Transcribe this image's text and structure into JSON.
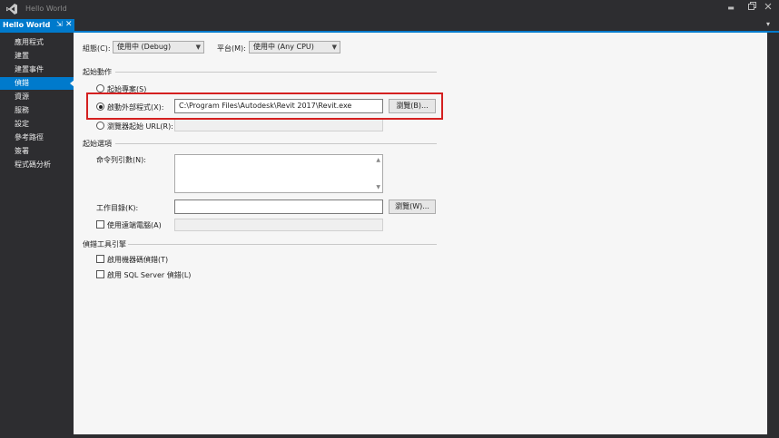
{
  "window": {
    "title": "Hello World",
    "min_glyph": "▬",
    "dropdown_glyph": "▾"
  },
  "tab": {
    "label": "Hello World",
    "pin_glyph": "⇲",
    "close_glyph": "✕"
  },
  "sidebar": {
    "items": [
      {
        "label": "應用程式",
        "selected": false
      },
      {
        "label": "建置",
        "selected": false
      },
      {
        "label": "建置事件",
        "selected": false
      },
      {
        "label": "偵錯",
        "selected": true
      },
      {
        "label": "資源",
        "selected": false
      },
      {
        "label": "服務",
        "selected": false
      },
      {
        "label": "設定",
        "selected": false
      },
      {
        "label": "參考路徑",
        "selected": false
      },
      {
        "label": "簽署",
        "selected": false
      },
      {
        "label": "程式碼分析",
        "selected": false
      }
    ]
  },
  "config": {
    "config_label": "組態(C):",
    "config_value": "使用中 (Debug)",
    "platform_label": "平台(M):",
    "platform_value": "使用中 (Any CPU)"
  },
  "start_action": {
    "header": "起始動作",
    "start_project": {
      "label": "起始專案(S)",
      "checked": false
    },
    "start_external": {
      "label": "啟動外部程式(X):",
      "checked": true,
      "value": "C:\\Program Files\\Autodesk\\Revit 2017\\Revit.exe",
      "browse_label": "瀏覽(B)..."
    },
    "start_browser": {
      "label": "瀏覽器起始 URL(R):",
      "checked": false,
      "value": ""
    }
  },
  "start_options": {
    "header": "起始選項",
    "args_label": "命令列引數(N):",
    "args_value": "",
    "workdir_label": "工作目錄(K):",
    "workdir_value": "",
    "workdir_browse_label": "瀏覽(W)...",
    "remote": {
      "label": "使用遠端電腦(A)",
      "checked": false,
      "value": ""
    }
  },
  "debugger_engines": {
    "header": "偵錯工具引擎",
    "native": {
      "label": "啟用機器碼偵錯(T)",
      "checked": false
    },
    "sql": {
      "label": "啟用 SQL Server 偵錯(L)",
      "checked": false
    }
  },
  "colors": {
    "accent": "#007acc",
    "highlight": "#d42020",
    "chrome": "#2d2d30",
    "content_bg": "#f6f6f6"
  }
}
